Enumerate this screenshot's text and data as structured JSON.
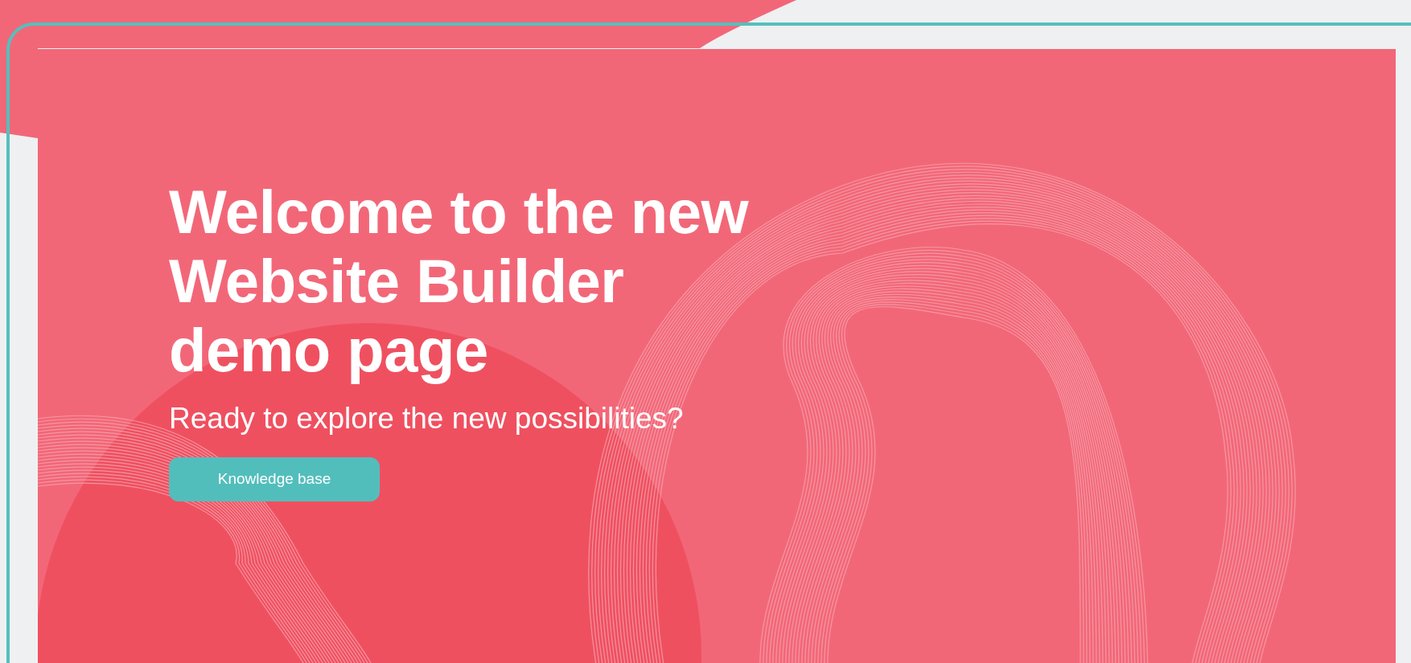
{
  "hero": {
    "title_lines": [
      "Welcome to the new",
      "Website Builder",
      "demo page"
    ],
    "subtitle": "Ready to explore the new possibilities?",
    "button": "Knowledge base"
  }
}
